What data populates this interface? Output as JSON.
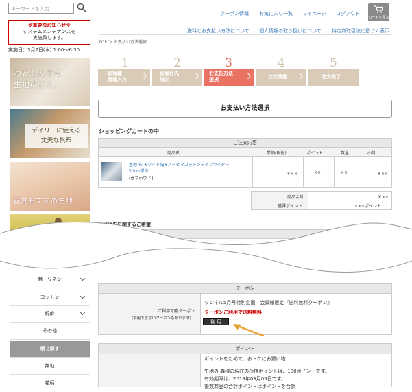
{
  "search": {
    "placeholder": "キーワードを入力"
  },
  "notice": {
    "title": "※重要なお知らせ※",
    "line1": "システムメンテナンスを",
    "line2": "実施致します。",
    "schedule": "実施日：3月7日(水) 1:00〜6:30"
  },
  "banners": {
    "b1_line1": "わたしたちの",
    "b1_line2": "生地のこと。",
    "b2_line1": "デイリーに使える",
    "b2_line2": "丈夫な帆布",
    "b3": "春夏おすすめ生地"
  },
  "header": {
    "links": [
      "クーポン情報",
      "お気に入り一覧",
      "マイページ",
      "ログアウト"
    ],
    "cart_label": "カートを見る",
    "sublinks": [
      "送料とお支払い方法について",
      "個人情報の取り扱いについて",
      "特定商取引法に基づく表示"
    ],
    "breadcrumb": "TOP ＞ お支払い方法選択"
  },
  "steps": [
    {
      "num": "1",
      "l1": "お客様",
      "l2": "情報入力"
    },
    {
      "num": "2",
      "l1": "お届け先",
      "l2": "指定"
    },
    {
      "num": "3",
      "l1": "お支払方法",
      "l2": "選択"
    },
    {
      "num": "4",
      "l1": "注文確認",
      "l2": ""
    },
    {
      "num": "5",
      "l1": "注文完了",
      "l2": ""
    }
  ],
  "page_title": "お支払い方法選択",
  "cart": {
    "heading": "ショッピングカートの中",
    "section": "ご注文内容",
    "cols": [
      "商品名",
      "単価(税込)",
      "ポイント",
      "数量",
      "小計"
    ],
    "item_name_1": "生地 布 ★ワイド幅★スーピマコットンタイプライター",
    "item_name_2": "50cm単位",
    "item_color": "(オフホワイト)",
    "price": "￥××",
    "points": "××",
    "qty": "××",
    "subtotal": "￥××",
    "total_label": "商品合計",
    "total_value": "￥××",
    "pts_label": "獲得ポイント",
    "pts_value": "×××ポイント"
  },
  "delivery_heading": "お届け先に関するご希望",
  "menu": {
    "items": [
      "麻・リネン",
      "コットン",
      "綿麻",
      "その他"
    ],
    "find": "柄で探す",
    "sub": [
      "無地",
      "花柄"
    ]
  },
  "coupon": {
    "head": "クーポン",
    "label": "ご利用可能クーポン",
    "note": "(併用できないクーポンもあります)",
    "name": "リンネル5月号特別企画　会員様限定『送料無料クーポン』",
    "applied": "クーポンご利用で送料無料",
    "use_button": "利 用",
    "accent": "#e8a033"
  },
  "points": {
    "head": "ポイント",
    "l1": "ポイントをためて、おトクにお買い物！",
    "l2": "生地の 森様の現在の所持ポイントは、100ポイントです。",
    "l3": "有効期限は、2019年03月05日です。",
    "l4": "複数商品の合計ポイントはポイントを合計"
  }
}
